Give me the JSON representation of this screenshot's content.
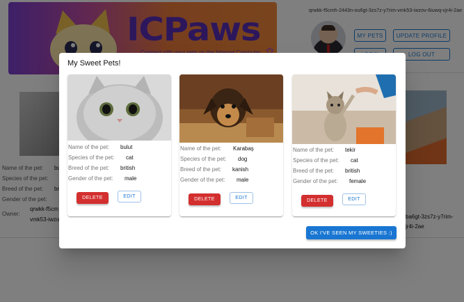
{
  "header": {
    "banner_title": "ICPaws",
    "banner_subtitle": "Connect with your pets on the Internet Computer",
    "user_principal": "qrwkk-f5cmh-2443n-ou6gt-3zs7z-y7rim-vmk53-iwzov-6iuwq-vjr4i-2ae",
    "buttons": {
      "my_pets": "MY PETS",
      "update_profile": "UPDATE PROFILE",
      "login": "LOGIN",
      "logout": "LOG OUT"
    }
  },
  "background": {
    "labels": [
      "Name of the pet:",
      "Species of the pet:",
      "Breed of the pet:",
      "Gender of the pet:"
    ],
    "owner_label": "Owner:",
    "owner_left_1": "qrwkk-f5cm",
    "owner_left_2": "vmk53-iwzo",
    "owner_right_1": "ba6gt-3zs7z-y7rim-",
    "owner_right_2": "jr4i-2ae",
    "peek_left": "bu",
    "peek_left_2": "br"
  },
  "dialog": {
    "title": "My Sweet Pets!",
    "field_labels": {
      "name": "Name of the pet:",
      "species": "Species of the pet:",
      "breed": "Breed of the pet:",
      "gender": "Gender of the pet:"
    },
    "delete_label": "DELETE",
    "edit_label": "EDIT",
    "pets": [
      {
        "name": "bulut",
        "species": "cat",
        "breed": "british",
        "gender": "male"
      },
      {
        "name": "Karabaş",
        "species": "dog",
        "breed": "kanish",
        "gender": "male"
      },
      {
        "name": "tekir",
        "species": "cat",
        "breed": "british",
        "gender": "female"
      }
    ],
    "ok_label": "OK I'VE SEEN MY SWEETIES :)"
  },
  "colors": {
    "primary": "#1976d2",
    "danger": "#d32f2f",
    "overlay": "rgba(0,0,0,0.5)"
  }
}
